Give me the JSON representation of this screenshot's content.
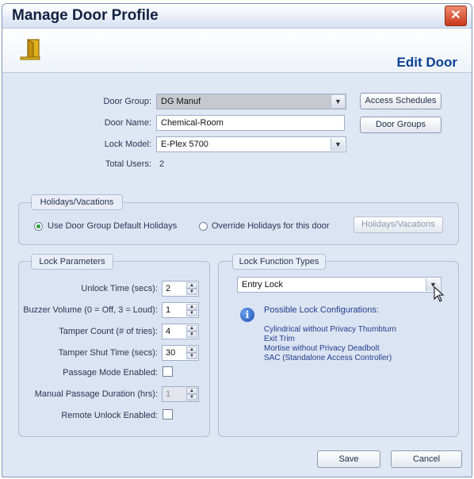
{
  "window": {
    "title": "Manage Door Profile",
    "close_glyph": "✕"
  },
  "header": {
    "subtitle": "Edit Door",
    "icon": "door-exit-icon"
  },
  "door": {
    "group_label": "Door Group:",
    "group_value": "DG Manuf",
    "name_label": "Door Name:",
    "name_value": "Chemical-Room",
    "lock_model_label": "Lock Model:",
    "lock_model_value": "E-Plex 5700",
    "total_users_label": "Total Users:",
    "total_users_value": "2"
  },
  "side_buttons": {
    "access_schedules": "Access Schedules",
    "door_groups": "Door Groups"
  },
  "holidays": {
    "legend": "Holidays/Vacations",
    "use_default": "Use Door Group Default Holidays",
    "override": "Override Holidays for this door",
    "button": "Holidays/Vacations",
    "selected": "use_default"
  },
  "lock_params": {
    "legend": "Lock Parameters",
    "unlock_time_label": "Unlock Time (secs):",
    "unlock_time_value": "2",
    "buzzer_label": "Buzzer Volume (0 = Off, 3 = Loud):",
    "buzzer_value": "1",
    "tamper_count_label": "Tamper Count (# of tries):",
    "tamper_count_value": "4",
    "tamper_shut_label": "Tamper Shut Time (secs):",
    "tamper_shut_value": "30",
    "passage_mode_label": "Passage Mode Enabled:",
    "passage_mode_checked": false,
    "manual_passage_label": "Manual Passage Duration (hrs):",
    "manual_passage_value": "1",
    "remote_unlock_label": "Remote Unlock Enabled:",
    "remote_unlock_checked": false
  },
  "lock_function": {
    "legend": "Lock Function Types",
    "selected": "Entry Lock",
    "configs_title": "Possible Lock Configurations:",
    "configs": [
      "Cylindrical without Privacy Thumbturn",
      "Exit Trim",
      "Mortise without Privacy Deadbolt",
      "SAC (Standalone Access Controller)"
    ]
  },
  "footer": {
    "save": "Save",
    "cancel": "Cancel"
  },
  "colors": {
    "accent_title": "#0b3f95",
    "panel_bg": "#dbe4f2",
    "close_red": "#c9391b"
  }
}
